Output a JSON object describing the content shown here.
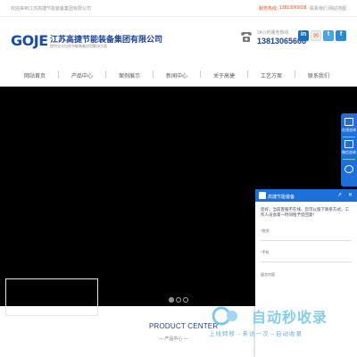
{
  "topbar": {
    "welcome": "欢迎来到江苏高捷节能装备集团有限公司",
    "hotline_label": "服务热线：",
    "hotline": "13813065608",
    "contact_link": "联系我们",
    "favorite_link": "网站地图"
  },
  "header": {
    "logo_text": "GOJE",
    "company_name": "江苏高捷节能装备集团有限公司",
    "company_sub": "提供全方位的节能装备应用解决方案",
    "phone_label": "24小时服务热线",
    "phone_number": "13813065608",
    "social": [
      "in",
      "✉",
      "t",
      "f"
    ]
  },
  "nav": {
    "items": [
      "网站首页",
      "产品中心",
      "案例展示",
      "新闻中心",
      "关于高捷",
      "工艺方案",
      "联系我们"
    ]
  },
  "banner": {
    "color": "#000000",
    "dots": 3,
    "active_dot": 0
  },
  "products": {
    "title": "PRODUCT CENTER",
    "subtitle": "— 产品中心 —"
  },
  "side_float": {
    "items": [
      "在线咨询",
      "微信咨询"
    ]
  },
  "chat": {
    "title": "高捷节能装备",
    "intro": "您好，当前客服不在线，您可以留下联系方式，工作人员会第一时间给予您回复！",
    "fields": [
      {
        "label": "姓名",
        "required": true
      },
      {
        "label": "手机",
        "required": true
      },
      {
        "label": "留言内容",
        "required": false
      }
    ],
    "controls": [
      "↗",
      "✕"
    ]
  },
  "watermark": {
    "brand": "自动秒收录",
    "tagline": "上线转移→来访一次→自动收录"
  },
  "colors": {
    "brand_blue": "#1b3f8f",
    "accent_blue": "#1e6fd8",
    "hotline_red": "#e84d1c"
  }
}
